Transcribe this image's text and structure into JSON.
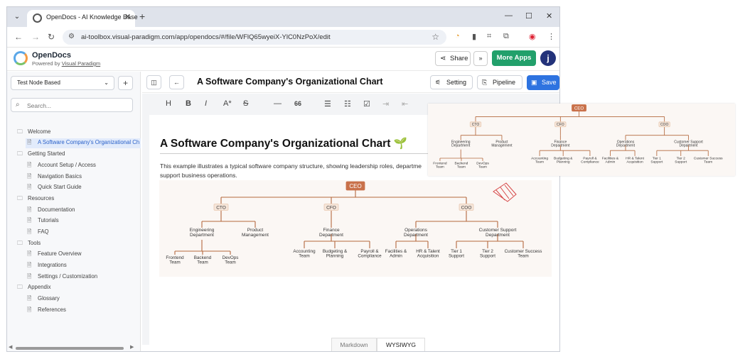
{
  "browser": {
    "tab_title": "OpenDocs - AI Knowledge Base",
    "url": "ai-toolbox.visual-paradigm.com/app/opendocs/#/file/WFlQ65wyeiX-YlC0NzPoX/edit"
  },
  "app": {
    "name": "OpenDocs",
    "powered_prefix": "Powered by ",
    "powered_link": "Visual Paradigm",
    "share_label": "Share",
    "more_apps_label": "More Apps",
    "avatar_letter": "j",
    "brand_color": "#22a06b"
  },
  "sidebar": {
    "node_select": "Test Node Based",
    "search_placeholder": "Search...",
    "tree": [
      {
        "label": "Welcome",
        "type": "folder"
      },
      {
        "label": "A Software Company's Organizational Ch",
        "type": "doc",
        "active": true
      },
      {
        "label": "Getting Started",
        "type": "folder"
      },
      {
        "label": "Account Setup / Access",
        "type": "doc"
      },
      {
        "label": "Navigation Basics",
        "type": "doc"
      },
      {
        "label": "Quick Start Guide",
        "type": "doc"
      },
      {
        "label": "Resources",
        "type": "folder"
      },
      {
        "label": "Documentation",
        "type": "doc"
      },
      {
        "label": "Tutorials",
        "type": "doc"
      },
      {
        "label": "FAQ",
        "type": "doc"
      },
      {
        "label": "Tools",
        "type": "folder"
      },
      {
        "label": "Feature Overview",
        "type": "doc"
      },
      {
        "label": "Integrations",
        "type": "doc"
      },
      {
        "label": "Settings / Customization",
        "type": "doc"
      },
      {
        "label": "Appendix",
        "type": "folder"
      },
      {
        "label": "Glossary",
        "type": "doc"
      },
      {
        "label": "References",
        "type": "doc"
      }
    ]
  },
  "editor": {
    "doc_title": "A Software Company's Organizational Chart",
    "setting_label": "Setting",
    "pipeline_label": "Pipeline",
    "save_label": "Save",
    "heading": "A Software Company's Organizational Chart",
    "heading_emoji": "🌱",
    "paragraph": "This example illustrates a typical software company structure, showing leadership roles, departme",
    "paragraph_line2": "support business operations.",
    "mode_markdown": "Markdown",
    "mode_wysiwyg": "WYSIWYG"
  },
  "org_chart": {
    "root": "CEO",
    "execs": [
      "CTO",
      "CFO",
      "COO"
    ],
    "departments": {
      "cto": [
        "Engineering Department",
        "Product Management"
      ],
      "cfo": [
        "Finance Department"
      ],
      "coo": [
        "Operations Department",
        "Customer Support Department"
      ]
    },
    "teams": {
      "engineering": [
        "Frontend Team",
        "Backend Team",
        "DevOps Team"
      ],
      "finance": [
        "Accounting Team",
        "Budgeting & Planning",
        "Payroll & Compliance"
      ],
      "operations": [
        "Facilities & Admin",
        "HR & Talent Acquisition"
      ],
      "support": [
        "Tier 1 Support",
        "Tier 2 Support",
        "Customer Success Team"
      ]
    },
    "line_color": "#b4683d",
    "root_color": "#c9714a"
  }
}
